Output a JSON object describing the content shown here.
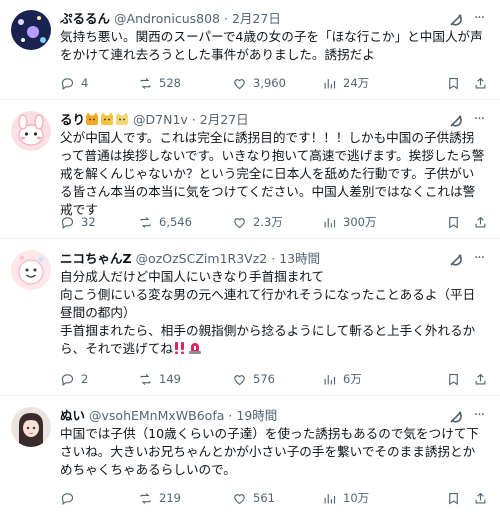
{
  "posts": [
    {
      "name": "ぷるるん",
      "handle": "@Andronicus808",
      "sep": "·",
      "time": "2月27日",
      "text": "気持ち悪い。関西のスーパーで4歳の女の子を「ほな行こか」と中国人が声をかけて連れ去ろうとした事件がありました。誘拐だよ",
      "replies": "4",
      "reposts": "528",
      "likes": "3,960",
      "views": "24万"
    },
    {
      "name": "るり",
      "handle": "@D7N1v",
      "sep": "·",
      "time": "2月27日",
      "text": "父が中国人です。これは完全に誘拐目的です！！！しかも中国の子供誘拐って普通は挨拶しないです。いきなり抱いて高速で逃げます。挨拶したら警戒を解くんじゃないか？という完全に日本人を舐めた行動です。子供がいる皆さん本当の本当に気をつけてください。中国人差別ではなくこれは警戒です",
      "replies": "32",
      "reposts": "6,546",
      "likes": "2.3万",
      "views": "300万"
    },
    {
      "name": "ニコちゃんZ",
      "handle": "@ozOzSCZim1R3Vz2",
      "sep": "·",
      "time": "13時間",
      "text": "自分成人だけど中国人にいきなり手首掴まれて\n向こう側にいる変な男の元へ連れて行かれそうになったことあるよ（平日昼間の都内）\n手首掴まれたら、相手の親指側から捻るようにして斬ると上手く外れるから、それで逃げてね",
      "replies": "2",
      "reposts": "149",
      "likes": "576",
      "views": "6万"
    },
    {
      "name": "ぬい",
      "handle": "@vsohEMnMxWB6ofa",
      "sep": "·",
      "time": "19時間",
      "text": "中国では子供（10歳くらいの子達）を使った誘拐もあるので気をつけて下さいね。大きいお兄ちゃんとかが小さい子の手を繋いでそのまま誘拐とかめちゃくちゃあるらしいので。",
      "replies": "",
      "reposts": "219",
      "likes": "561",
      "views": "10万"
    }
  ],
  "icons": {
    "reply": "reply-icon",
    "repost": "repost-icon",
    "like": "heart-icon",
    "views": "views-icon",
    "bookmark": "bookmark-icon",
    "share": "share-icon",
    "grok": "grok-icon",
    "more": "more-icon"
  },
  "colors": {
    "text": "#0f1419",
    "meta": "#536471",
    "divider": "#eff3f4",
    "emoji_red": "#e0245e"
  }
}
